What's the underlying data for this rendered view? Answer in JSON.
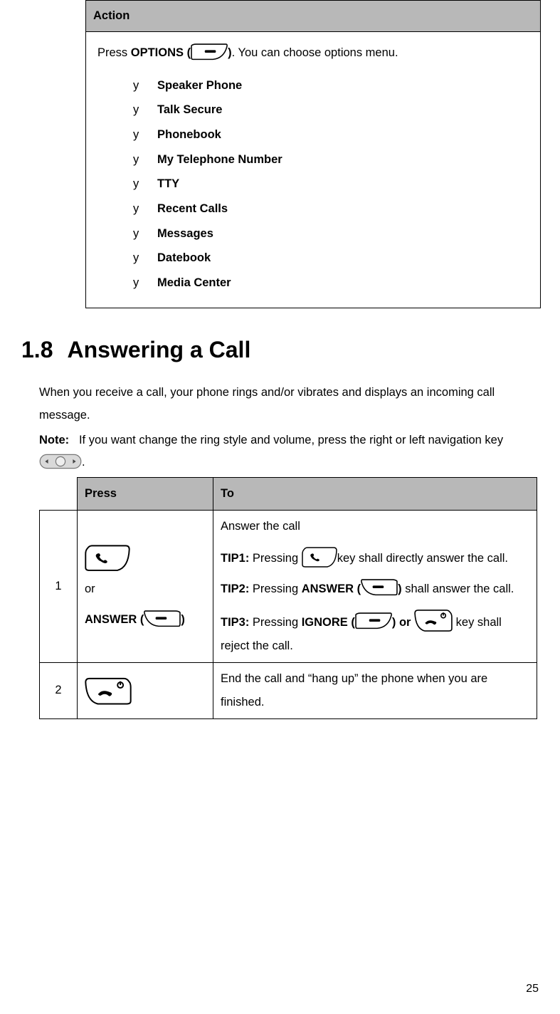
{
  "table1": {
    "header": "Action",
    "press_prefix": "Press ",
    "options_label": "OPTIONS (",
    "options_close": ")",
    "press_suffix": ". You can choose options menu.",
    "items": [
      "Speaker Phone",
      "Talk Secure",
      "Phonebook",
      "My Telephone Number",
      "TTY",
      "Recent Calls",
      "Messages",
      "Datebook",
      "Media Center"
    ]
  },
  "section": {
    "number": "1.8",
    "title": "Answering a Call"
  },
  "intro": "When you receive a call, your phone rings and/or vibrates and displays an incoming call message.",
  "note_label": "Note:",
  "note_text_a": "If you want change the ring style and volume, press the right or left navigation key ",
  "note_text_b": ".",
  "table2": {
    "header_press": "Press",
    "header_to": "To",
    "rows": [
      {
        "num": "1",
        "or": "or",
        "answer_a": "ANSWER (",
        "answer_b": ")",
        "to_first": "Answer the call",
        "tip1_label": "TIP1:",
        "tip1_a": " Pressing ",
        "tip1_b": "key shall directly answer the call.",
        "tip2_label": "TIP2:",
        "tip2_a": " Pressing ",
        "tip2_ans_a": "ANSWER (",
        "tip2_ans_b": ")",
        "tip2_c": " shall answer the call.",
        "tip3_label": "TIP3:",
        "tip3_a": " Pressing ",
        "tip3_ign_a": "IGNORE (",
        "tip3_ign_b": ") or ",
        "tip3_c": " key shall reject the call."
      },
      {
        "num": "2",
        "to": "End the call and “hang up” the phone when you are finished."
      }
    ]
  },
  "page_number": "25"
}
